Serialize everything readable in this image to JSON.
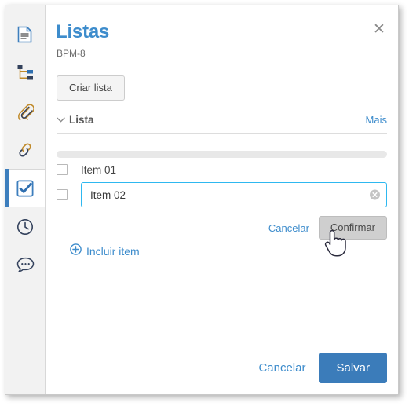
{
  "window": {
    "close_label": "✕"
  },
  "sidebar": {
    "items": [
      {
        "name": "document-icon",
        "label": "Documento",
        "active": false
      },
      {
        "name": "hierarchy-icon",
        "label": "Hierarquia",
        "active": false
      },
      {
        "name": "paperclip-icon",
        "label": "Anexos",
        "active": false
      },
      {
        "name": "link-icon",
        "label": "Links",
        "active": false
      },
      {
        "name": "checklist-icon",
        "label": "Listas",
        "active": true
      },
      {
        "name": "clock-icon",
        "label": "Histórico",
        "active": false
      },
      {
        "name": "comment-icon",
        "label": "Comentários",
        "active": false
      }
    ]
  },
  "header": {
    "title": "Listas",
    "subtitle": "BPM-8",
    "create_list_label": "Criar lista"
  },
  "section": {
    "chevron": "⌄",
    "title": "Lista",
    "more_label": "Mais",
    "progress_percent": 0
  },
  "items": [
    {
      "type": "text",
      "label": "Item 01",
      "checked": false
    },
    {
      "type": "input",
      "value": "Item 02",
      "placeholder": "",
      "checked": false,
      "clear_icon": "clear-icon"
    }
  ],
  "inline_actions": {
    "cancel_label": "Cancelar",
    "confirm_label": "Confirmar"
  },
  "add_item": {
    "icon": "plus-circle-icon",
    "label": "Incluir item"
  },
  "footer": {
    "cancel_label": "Cancelar",
    "save_label": "Salvar"
  },
  "colors": {
    "accent_blue": "#3d8ccc",
    "primary_button": "#3b7cba",
    "input_focus_border": "#2eb8f0",
    "rail_bg": "#f2f2f2",
    "progress_track": "#e8e8e8"
  }
}
